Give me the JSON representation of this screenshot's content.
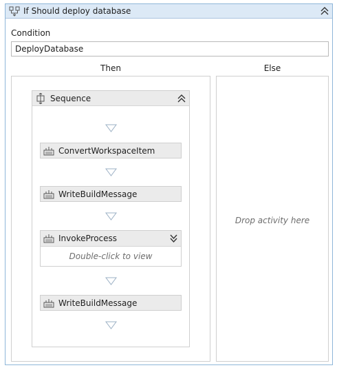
{
  "if_activity": {
    "title": "If Should deploy database",
    "condition_label": "Condition",
    "condition_value": "DeployDatabase",
    "then_label": "Then",
    "else_label": "Else",
    "else_placeholder": "Drop activity here"
  },
  "sequence": {
    "title": "Sequence",
    "activities": [
      {
        "label": "ConvertWorkspaceItem"
      },
      {
        "label": "WriteBuildMessage"
      },
      {
        "label": "InvokeProcess",
        "placeholder": "Double-click to view"
      },
      {
        "label": "WriteBuildMessage"
      }
    ]
  },
  "icons": {
    "if": "if-activity-icon",
    "sequence": "sequence-icon",
    "activity": "activity-icon",
    "collapse": "double-chevron-up-icon",
    "expand": "double-chevron-down-icon",
    "drop_target": "triangle-down-icon"
  }
}
